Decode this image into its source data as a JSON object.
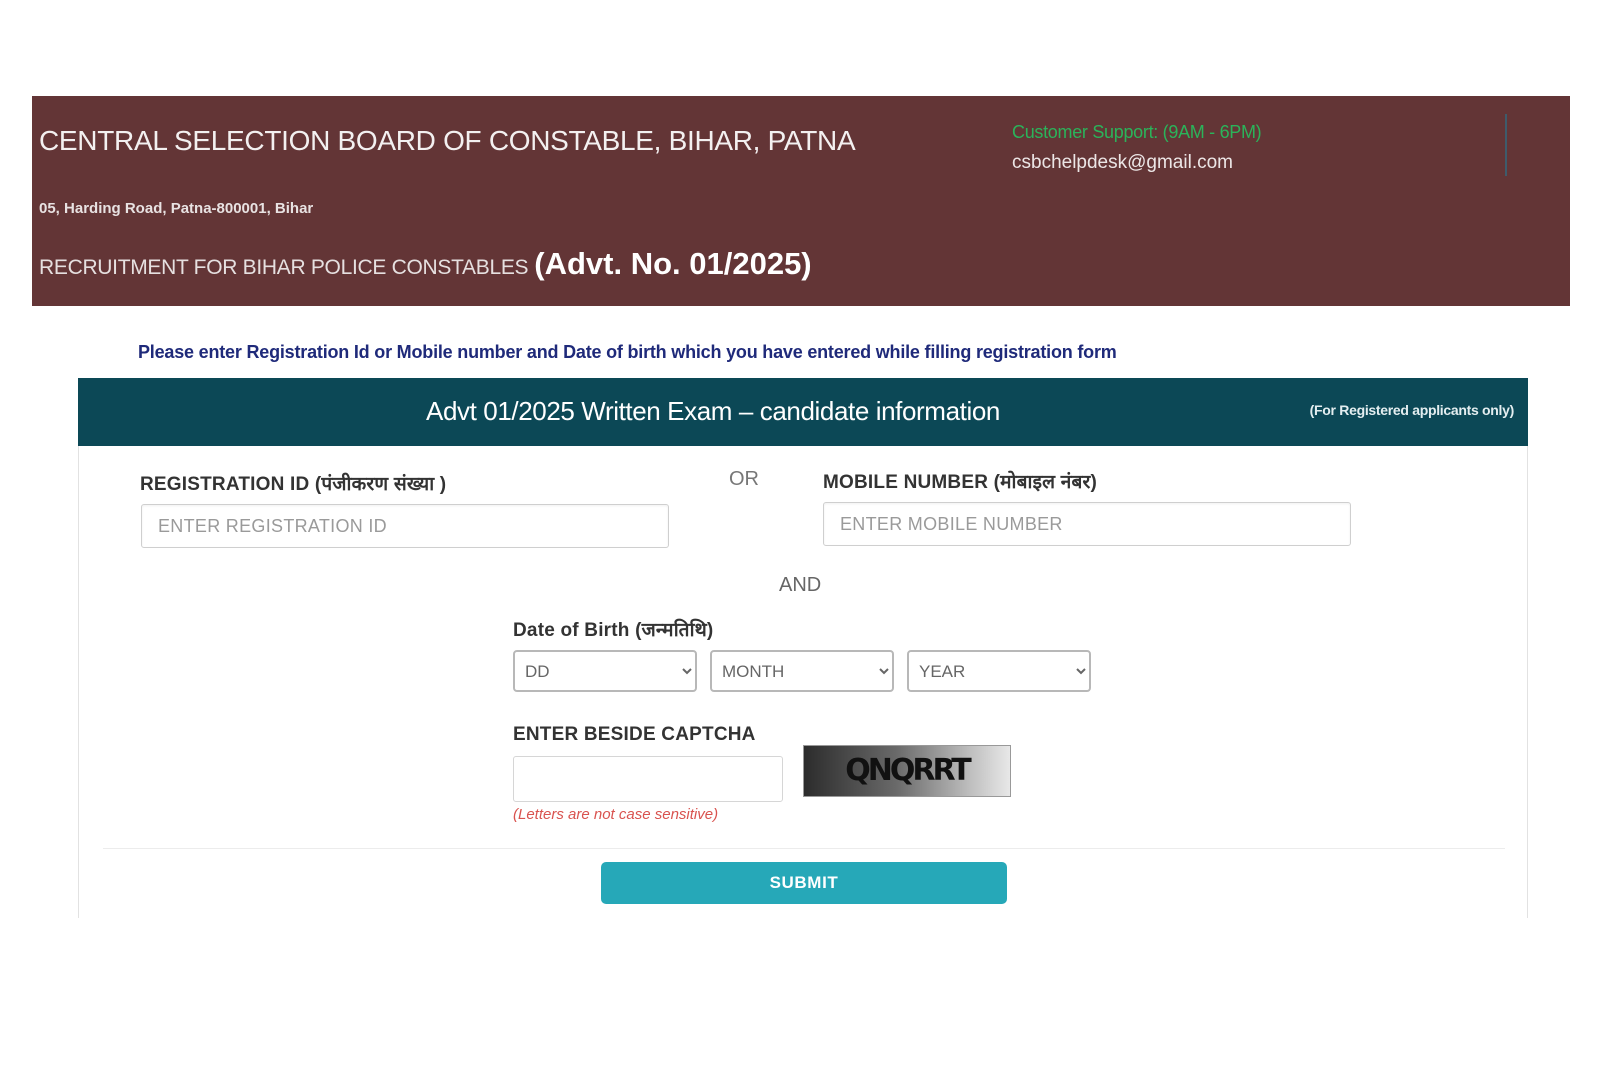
{
  "header": {
    "org_title": "CENTRAL SELECTION BOARD OF CONSTABLE, BIHAR, PATNA",
    "address": "05, Harding Road, Patna-800001, Bihar",
    "recruitment_text": "RECRUITMENT FOR BIHAR POLICE CONSTABLES",
    "advt_no": "(Advt. No. 01/2025)",
    "support_label": "Customer Support: (9AM - 6PM)",
    "support_email": "csbchelpdesk@gmail.com"
  },
  "instruction": "Please enter Registration Id or Mobile number and Date of birth which you have entered while filling registration form",
  "panel": {
    "title": "Advt 01/2025 Written Exam – candidate information",
    "note": "(For Registered applicants only)"
  },
  "form": {
    "registration_label": "REGISTRATION ID (पंजीकरण संख्या )",
    "registration_placeholder": "ENTER REGISTRATION ID",
    "or_text": "OR",
    "mobile_label": "MOBILE NUMBER (मोबाइल नंबर)",
    "mobile_placeholder": "ENTER MOBILE NUMBER",
    "and_text": "AND",
    "dob_label": "Date of Birth (जन्मतिथि)",
    "dob_day": "DD",
    "dob_month": "MONTH",
    "dob_year": "YEAR",
    "captcha_label": "ENTER BESIDE CAPTCHA",
    "captcha_text": "QNQRRT",
    "captcha_note": "(Letters are not case sensitive)",
    "submit_label": "SUBMIT"
  },
  "colors": {
    "header_bg": "#633536",
    "panel_head_bg": "#0c4856",
    "submit_bg": "#26a8b8",
    "instruction_text": "#1f2a7a",
    "support_text": "#2bb35a",
    "note_red": "#d9534f"
  }
}
